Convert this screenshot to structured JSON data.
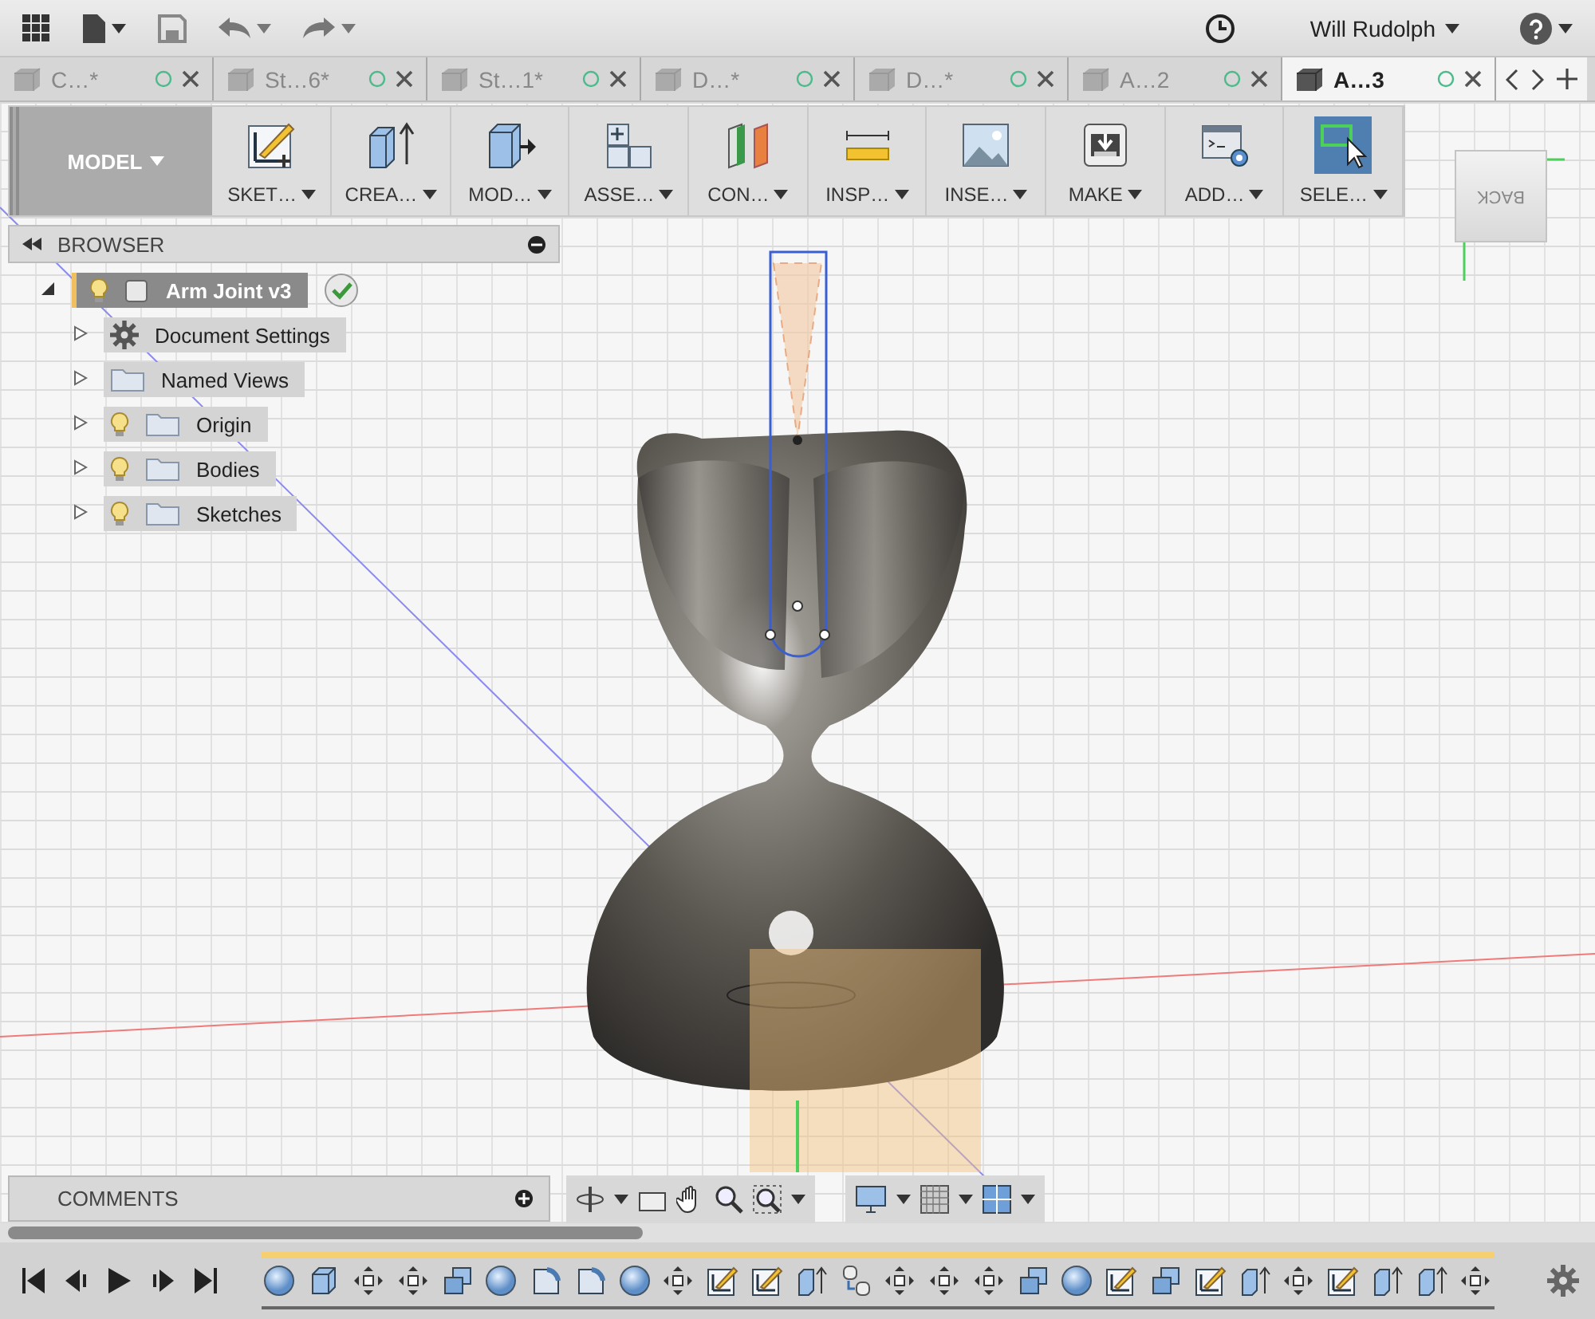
{
  "top_bar": {
    "user": "Will Rudolph"
  },
  "tabs": [
    {
      "label": "C…*",
      "selected": false
    },
    {
      "label": "St…6*",
      "selected": false
    },
    {
      "label": "St…1*",
      "selected": false
    },
    {
      "label": "D…*",
      "selected": false
    },
    {
      "label": "D…*",
      "selected": false
    },
    {
      "label": "A…2",
      "selected": false
    },
    {
      "label": "A…3",
      "selected": true
    }
  ],
  "ribbon": {
    "workspace": "MODEL",
    "tools": [
      {
        "kind": "sketch",
        "label": "SKET…",
        "selected": false
      },
      {
        "kind": "create",
        "label": "CREA…",
        "selected": false
      },
      {
        "kind": "modify",
        "label": "MOD…",
        "selected": false
      },
      {
        "kind": "assemble",
        "label": "ASSE…",
        "selected": false
      },
      {
        "kind": "construct",
        "label": "CON…",
        "selected": false
      },
      {
        "kind": "inspect",
        "label": "INSP…",
        "selected": false
      },
      {
        "kind": "insert",
        "label": "INSE…",
        "selected": false
      },
      {
        "kind": "make",
        "label": "MAKE",
        "selected": false
      },
      {
        "kind": "addins",
        "label": "ADD…",
        "selected": false
      },
      {
        "kind": "select",
        "label": "SELE…",
        "selected": true
      }
    ]
  },
  "view_cube": {
    "face": "BACK"
  },
  "browser": {
    "title": "BROWSER",
    "root": {
      "label": "Arm Joint v3",
      "expanded": true,
      "children": [
        {
          "label": "Document Settings",
          "kind": "settings",
          "expanded": false
        },
        {
          "label": "Named Views",
          "kind": "folder",
          "expanded": false
        },
        {
          "label": "Origin",
          "kind": "light-folder",
          "expanded": false
        },
        {
          "label": "Bodies",
          "kind": "light-folder",
          "expanded": false
        },
        {
          "label": "Sketches",
          "kind": "light-folder",
          "expanded": false
        }
      ]
    }
  },
  "comments": {
    "title": "COMMENTS"
  },
  "timeline": {
    "features": [
      {
        "kind": "sphere"
      },
      {
        "kind": "box"
      },
      {
        "kind": "move"
      },
      {
        "kind": "move"
      },
      {
        "kind": "combine"
      },
      {
        "kind": "sphere"
      },
      {
        "kind": "fillet"
      },
      {
        "kind": "fillet"
      },
      {
        "kind": "sphere"
      },
      {
        "kind": "move"
      },
      {
        "kind": "sketch"
      },
      {
        "kind": "sketch"
      },
      {
        "kind": "extrude"
      },
      {
        "kind": "joint"
      },
      {
        "kind": "move"
      },
      {
        "kind": "move"
      },
      {
        "kind": "move"
      },
      {
        "kind": "combine"
      },
      {
        "kind": "sphere"
      },
      {
        "kind": "sketch"
      },
      {
        "kind": "combine"
      },
      {
        "kind": "sketch"
      },
      {
        "kind": "extrude"
      },
      {
        "kind": "move"
      },
      {
        "kind": "sketch"
      },
      {
        "kind": "extrude"
      },
      {
        "kind": "extrude"
      },
      {
        "kind": "move"
      }
    ]
  }
}
